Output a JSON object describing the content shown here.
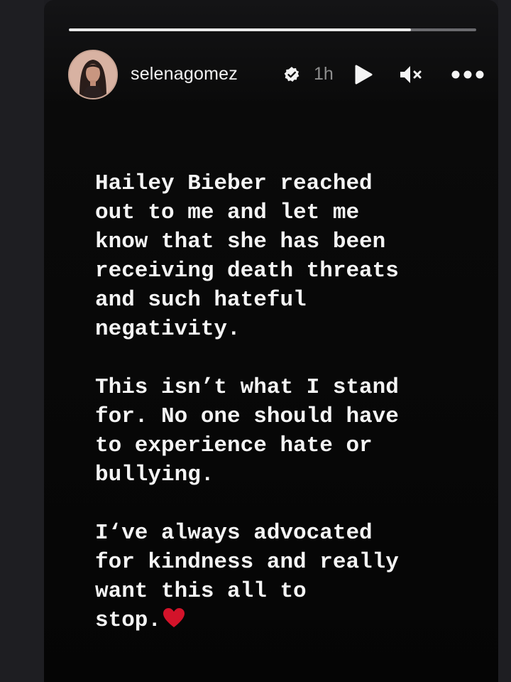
{
  "story": {
    "progress": 0.84,
    "author": {
      "username": "selenagomez",
      "verified": true,
      "avatar_icon": "profile-photo"
    },
    "timestamp": "1h",
    "controls": {
      "play_icon": "play-icon",
      "mute_icon": "muted-speaker-icon",
      "more_icon": "more-options-icon"
    },
    "text": {
      "paragraph_1": "Hailey Bieber reached\nout to me and let me\nknow that she has been\nreceiving death threats\nand such hateful\nnegativity.",
      "paragraph_2": "This isn’t what I stand\nfor. No one should have\nto experience hate or\nbullying.",
      "paragraph_3": "I‘ve always advocated\nfor kindness and really\nwant this all to\nstop."
    },
    "emoji": "heart",
    "colors": {
      "background": "#050505",
      "text": "#f4f4f4",
      "heart": "#d3132a",
      "progress_fill": "#e9e9e9",
      "progress_track": "#6a6a6e"
    }
  }
}
